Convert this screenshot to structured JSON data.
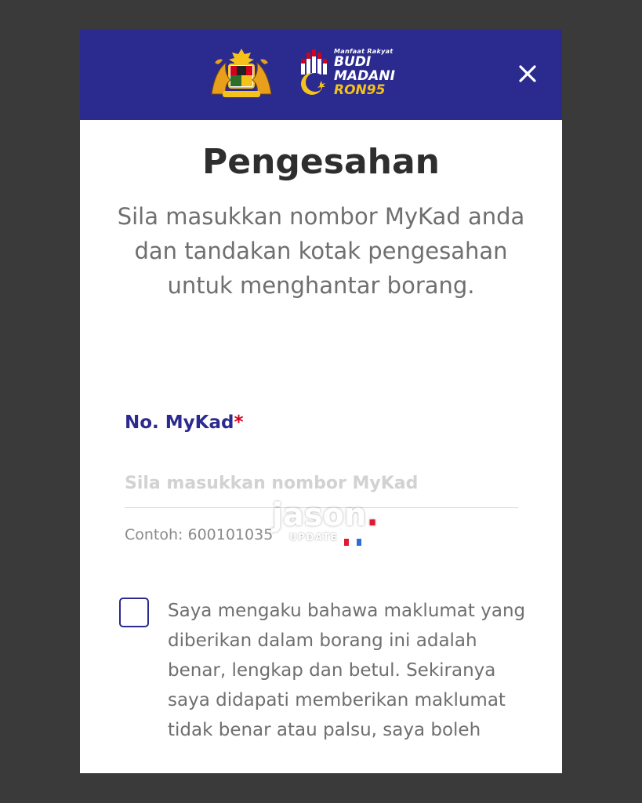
{
  "header": {
    "crest_icon": "malaysia-coat-of-arms-icon",
    "logo": {
      "tagline": "Manfaat Rakyat",
      "line1": "BUDI",
      "line2": "MADANI",
      "line3": "RON95"
    },
    "close_icon": "close-icon",
    "background_color": "#2b2a8f"
  },
  "title": "Pengesahan",
  "subtitle": "Sila masukkan nombor MyKad anda dan tandakan kotak pengesahan untuk menghantar borang.",
  "mykad": {
    "label": "No. MyKad",
    "required_marker": "*",
    "placeholder": "Sila masukkan nombor MyKad",
    "value": "",
    "hint": "Contoh: 600101035"
  },
  "watermark": {
    "brand": "jason",
    "dot": ".",
    "sub": "UPDATE"
  },
  "consent": {
    "checked": false,
    "text": "Saya mengaku bahawa maklumat yang diberikan dalam borang ini adalah benar, lengkap dan betul. Sekiranya saya didapati memberikan maklumat tidak benar atau palsu, saya boleh"
  },
  "colors": {
    "accent": "#2b2a8f",
    "required": "#d0021b",
    "ron95_yellow": "#f4c21b"
  }
}
